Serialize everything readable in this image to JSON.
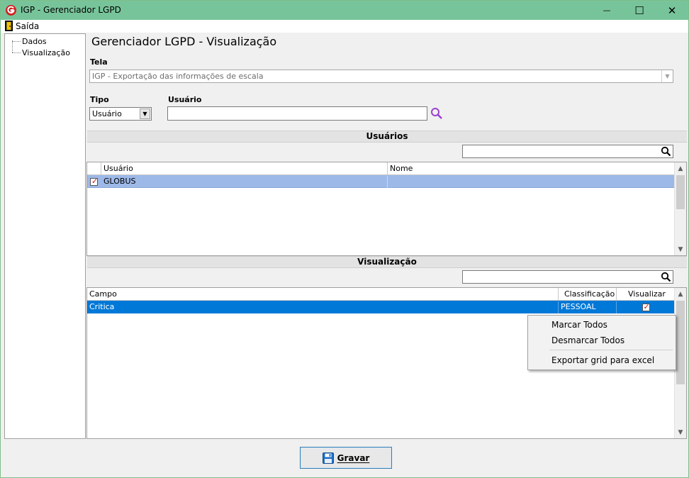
{
  "window": {
    "title": "IGP - Gerenciador LGPD",
    "minimize": "—",
    "maximize": "☐",
    "close": "✕"
  },
  "menu": {
    "exit_label": "Saída"
  },
  "tree": {
    "items": [
      {
        "label": "Dados"
      },
      {
        "label": "Visualização"
      }
    ]
  },
  "page": {
    "title": "Gerenciador LGPD - Visualização"
  },
  "tela": {
    "label": "Tela",
    "value": "IGP - Exportação das informações de escala"
  },
  "tipo": {
    "label": "Tipo",
    "value": "Usuário"
  },
  "usuario": {
    "label": "Usuário",
    "value": ""
  },
  "users_section": {
    "title": "Usuários",
    "columns": [
      "Usuário",
      "Nome"
    ],
    "rows": [
      {
        "checked": true,
        "usuario": "GLOBUS",
        "nome": ""
      }
    ]
  },
  "view_section": {
    "title": "Visualização",
    "columns": [
      "Campo",
      "Classificação",
      "Visualizar"
    ],
    "rows": [
      {
        "campo": "Critica",
        "classificacao": "PESSOAL",
        "visualizar": true
      }
    ]
  },
  "context_menu": {
    "items": [
      "Marcar Todos",
      "Desmarcar Todos",
      "Exportar grid para excel"
    ]
  },
  "actions": {
    "save_label": "Gravar"
  },
  "colors": {
    "titlebar": "#78c49a",
    "row_selected_light": "#9db9e8",
    "row_selected": "#0078d7",
    "check_mark": "#d01010",
    "search_purple": "#9b3fd0"
  }
}
